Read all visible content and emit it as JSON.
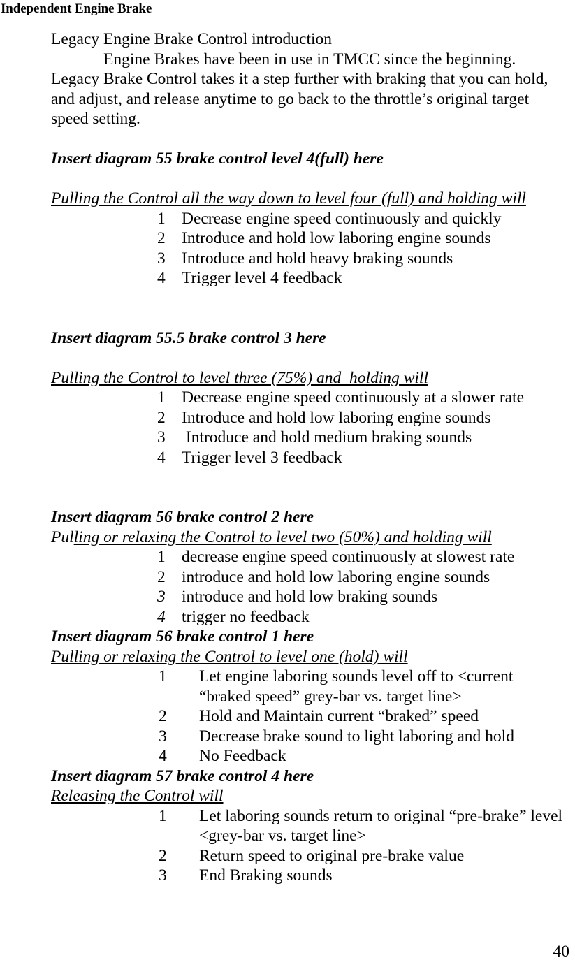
{
  "document": {
    "title": "Independent Engine Brake",
    "page_number": "40"
  },
  "intro": {
    "line1": "Legacy Engine Brake Control introduction",
    "line2_indented": "Engine Brakes have been in use in TMCC since the beginning.",
    "line3": "Legacy Brake Control takes it a step further with braking that you can hold, and adjust, and release anytime to go back to the throttle’s original target speed setting."
  },
  "sections": [
    {
      "heading": "Insert diagram 55 brake control level 4(full) here",
      "lead_in_plain": "",
      "lead_in_underlined": "Pulling the Control all the way down to level four (full) and holding will",
      "items": [
        {
          "num": "1",
          "num_italic": false,
          "text": "Decrease engine speed continuously and quickly"
        },
        {
          "num": "2",
          "num_italic": false,
          "text": "Introduce and hold low laboring engine sounds"
        },
        {
          "num": "3",
          "num_italic": false,
          "text": "Introduce and hold heavy braking sounds"
        },
        {
          "num": "4",
          "num_italic": false,
          "text": "Trigger level 4 feedback"
        }
      ]
    },
    {
      "heading": "Insert diagram 55.5 brake control 3 here",
      "lead_in_plain": "",
      "lead_in_underlined": "Pulling the Control to level three (75%) and  holding will",
      "items": [
        {
          "num": "1",
          "num_italic": false,
          "text": "Decrease engine speed continuously at a slower rate"
        },
        {
          "num": "2",
          "num_italic": false,
          "text": "Introduce and hold low laboring engine sounds"
        },
        {
          "num": "3",
          "num_italic": false,
          "text": " Introduce and hold medium braking sounds"
        },
        {
          "num": "4",
          "num_italic": false,
          "text": "Trigger level 3 feedback"
        }
      ]
    },
    {
      "heading": "Insert diagram 56 brake control 2 here",
      "lead_in_plain": "Pul",
      "lead_in_underlined": "ling or relaxing the Control to level two (50%) and holding will",
      "items": [
        {
          "num": "1",
          "num_italic": false,
          "text": "decrease engine speed continuously at slowest rate"
        },
        {
          "num": "2",
          "num_italic": false,
          "text": "introduce and hold low laboring engine sounds"
        },
        {
          "num": "3",
          "num_italic": true,
          "text": "introduce and hold low braking sounds"
        },
        {
          "num": "4",
          "num_italic": true,
          "text": "trigger no feedback"
        }
      ]
    },
    {
      "heading": "Insert diagram 56 brake control 1 here",
      "lead_in_plain": "",
      "lead_in_underlined": "Pulling or relaxing the Control to level one (hold) will",
      "items": [
        {
          "num": "1",
          "num_italic": false,
          "text": "Let engine laboring sounds level off to <current “braked speed” grey-bar vs. target line>"
        },
        {
          "num": "2",
          "num_italic": false,
          "text": "Hold and Maintain current “braked” speed"
        },
        {
          "num": "3",
          "num_italic": false,
          "text": "Decrease brake sound to light laboring and hold"
        },
        {
          "num": "4",
          "num_italic": false,
          "text": "No Feedback"
        }
      ]
    },
    {
      "heading": "Insert diagram 57 brake control 4 here",
      "lead_in_plain": "",
      "lead_in_underlined": "Releasing the Control will",
      "items": [
        {
          "num": "1",
          "num_italic": false,
          "text": "Let laboring sounds return to original “pre-brake” level <grey-bar vs. target line>"
        },
        {
          "num": "2",
          "num_italic": false,
          "text": "Return speed to original pre-brake value"
        },
        {
          "num": "3",
          "num_italic": false,
          "text": "End Braking sounds"
        }
      ]
    }
  ]
}
